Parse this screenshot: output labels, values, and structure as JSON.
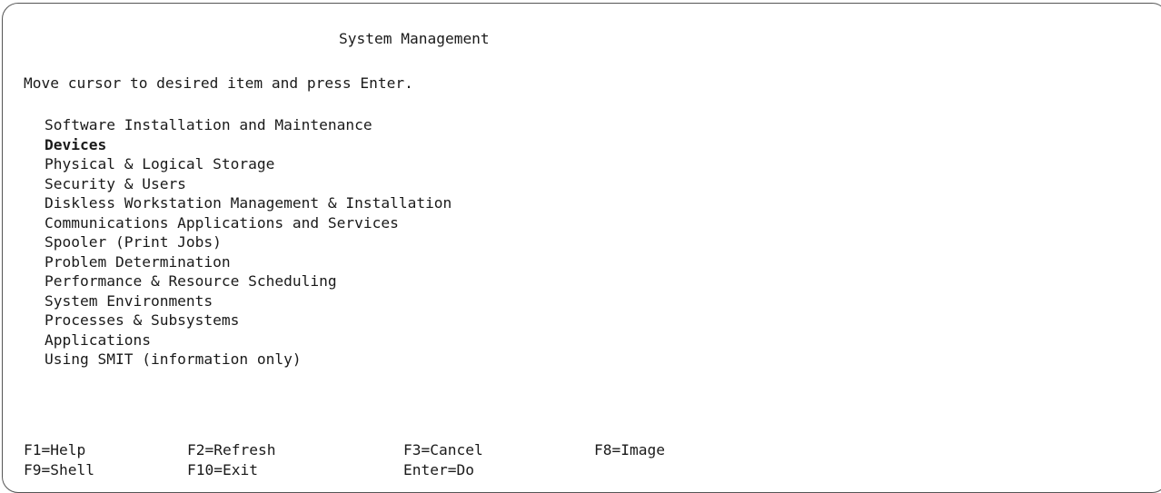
{
  "screen": {
    "title": "System Management",
    "instruction": "Move cursor to desired item and press Enter."
  },
  "menu": {
    "selected_index": 1,
    "items": [
      {
        "label": "Software Installation and Maintenance"
      },
      {
        "label": "Devices"
      },
      {
        "label": "Physical & Logical Storage"
      },
      {
        "label": "Security & Users"
      },
      {
        "label": "Diskless Workstation Management & Installation"
      },
      {
        "label": "Communications Applications and Services"
      },
      {
        "label": "Spooler (Print Jobs)"
      },
      {
        "label": "Problem Determination"
      },
      {
        "label": "Performance & Resource Scheduling"
      },
      {
        "label": "System Environments"
      },
      {
        "label": "Processes & Subsystems"
      },
      {
        "label": "Applications"
      },
      {
        "label": "Using SMIT (information only)"
      }
    ]
  },
  "function_keys": {
    "row1": [
      "F1=Help",
      "F2=Refresh",
      "F3=Cancel",
      "F8=Image"
    ],
    "row2": [
      "F9=Shell",
      "F10=Exit",
      "Enter=Do"
    ]
  }
}
